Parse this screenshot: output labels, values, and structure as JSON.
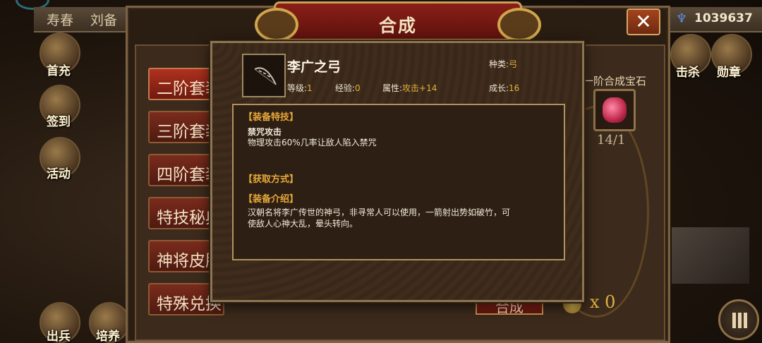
{
  "topbar": {
    "left_labels": [
      "寿春",
      "刘备"
    ],
    "power_value": "1039637"
  },
  "left_icons": [
    {
      "label": "首充",
      "icon": "gift-icon"
    },
    {
      "label": "签到",
      "icon": "signin-icon"
    },
    {
      "label": "活动",
      "icon": "event-icon"
    },
    {
      "label": "出兵",
      "icon": "deploy-icon"
    },
    {
      "label": "培养",
      "icon": "train-icon"
    }
  ],
  "right_icons": [
    {
      "label": "击杀",
      "icon": "swords-icon"
    },
    {
      "label": "勋章",
      "icon": "medal-icon"
    }
  ],
  "panel": {
    "title": "合成",
    "menu": [
      {
        "label": "二阶套装",
        "active": true
      },
      {
        "label": "三阶套装",
        "active": false
      },
      {
        "label": "四阶套装",
        "active": false
      },
      {
        "label": "特技秘典",
        "active": false
      },
      {
        "label": "神将皮肤",
        "active": false
      },
      {
        "label": "特殊兑换",
        "active": false
      }
    ],
    "gem_label": "一阶合成宝石",
    "gem_count": "14/1",
    "synth_button": "合成",
    "multiplier": "x 0"
  },
  "tooltip": {
    "item_name": "李广之弓",
    "level_label": "等级:",
    "level_value": "1",
    "exp_label": "经验:",
    "exp_value": "0",
    "attr_label": "属性:",
    "attr_value": "攻击+14",
    "type_label": "种类:",
    "type_value": "弓",
    "growth_label": "成长:",
    "growth_value": "16",
    "skill_head": "【装备特技】",
    "skill_name": "禁咒攻击",
    "skill_desc": "物理攻击60%几率让敌人陷入禁咒",
    "obtain_head": "【获取方式】",
    "intro_head": "【装备介绍】",
    "intro_line1": "汉朝名将李广传世的神弓，非寻常人可以使用，一箭射出势如破竹，可",
    "intro_line2": "使敌人心神大乱，晕头转向。"
  },
  "colors": {
    "accent_gold": "#e3b23c",
    "section_orange": "#e8a93a",
    "title_red": "#8a1f18"
  }
}
